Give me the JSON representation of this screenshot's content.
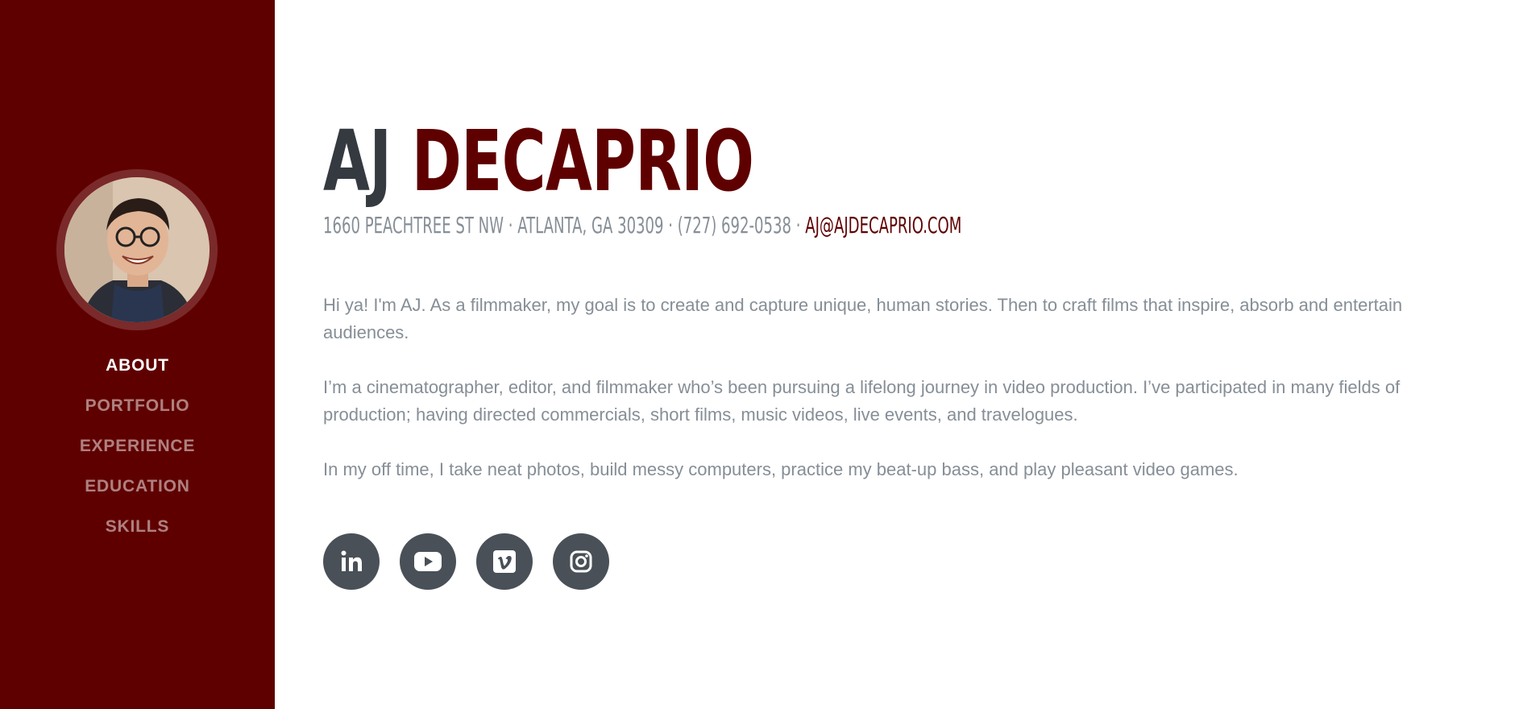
{
  "sidebar": {
    "nav": [
      {
        "label": "ABOUT",
        "active": true
      },
      {
        "label": "PORTFOLIO",
        "active": false
      },
      {
        "label": "EXPERIENCE",
        "active": false
      },
      {
        "label": "EDUCATION",
        "active": false
      },
      {
        "label": "SKILLS",
        "active": false
      }
    ]
  },
  "header": {
    "first_name": "AJ",
    "last_name": "DECAPRIO",
    "address": "1660 PEACHTREE ST NW · ATLANTA, GA 30309 · (727) 692-0538 ·",
    "email": "AJ@AJDECAPRIO.COM"
  },
  "about": {
    "p1": "Hi ya! I'm AJ. As a filmmaker, my goal is to create and capture unique, human stories. Then to craft films that inspire, absorb and entertain audiences.",
    "p2": "I’m a cinematographer, editor, and filmmaker who’s been pursuing a lifelong journey in video production. I’ve participated in many fields of production; having directed commercials, short films, music videos, live events, and travelogues.",
    "p3": "In my off time, I take neat photos, build messy computers, practice my beat-up bass, and play pleasant video games."
  },
  "social": [
    "linkedin-icon",
    "youtube-icon",
    "vimeo-icon",
    "instagram-icon"
  ],
  "colors": {
    "brand": "#5f0000",
    "text_dark": "#343a40",
    "text_muted": "#868e96",
    "social_bg": "#495057"
  }
}
